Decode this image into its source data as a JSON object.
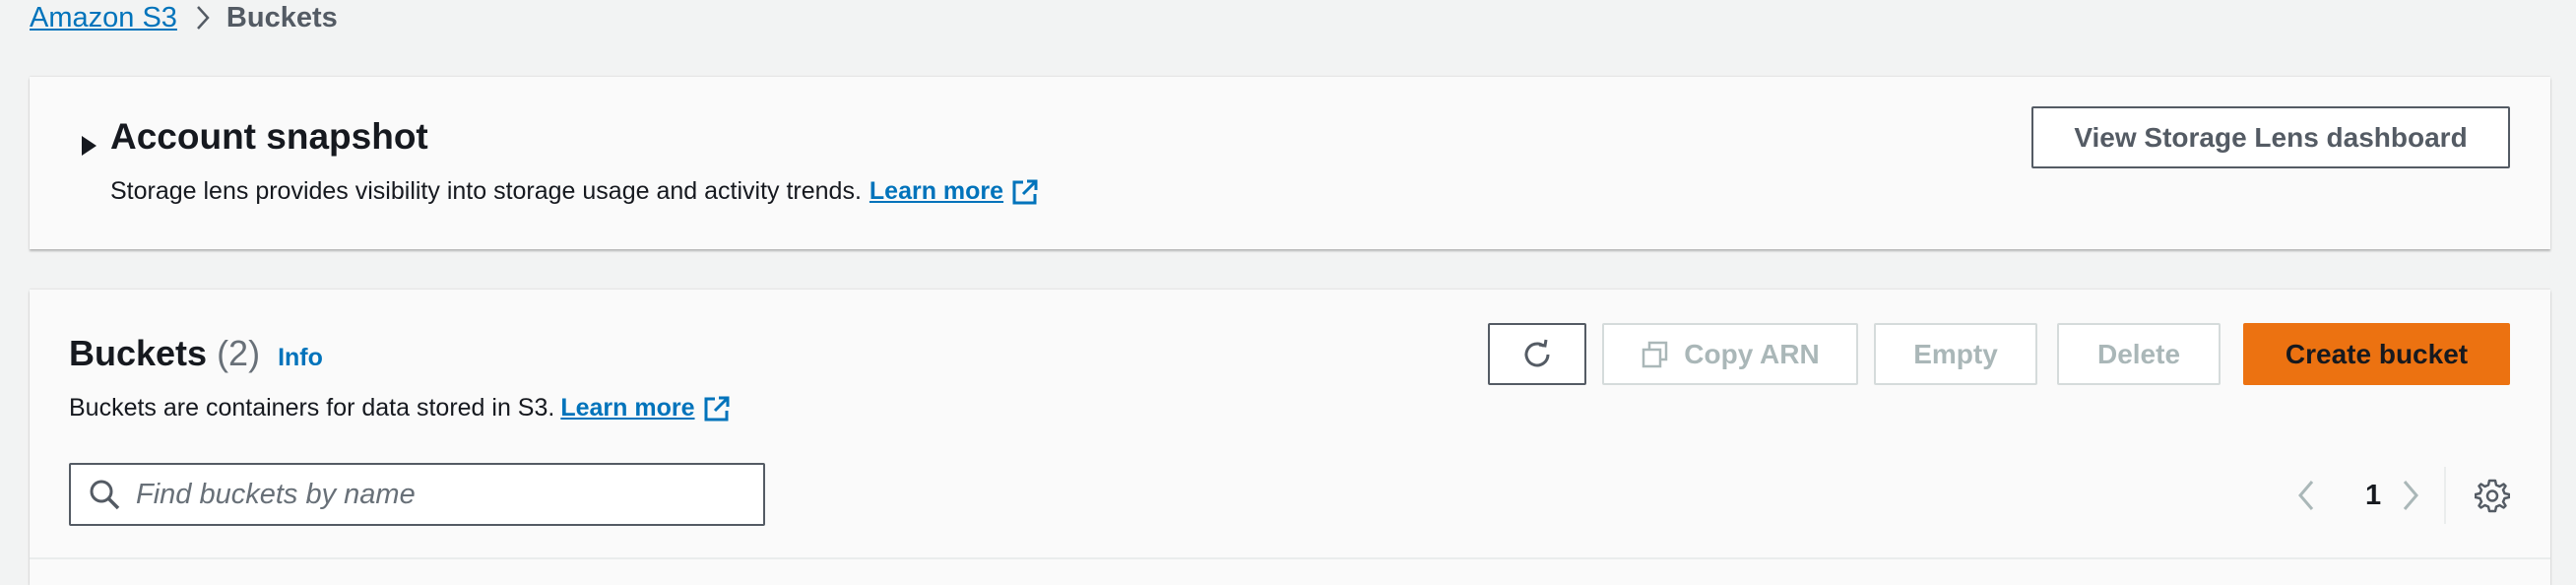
{
  "breadcrumb": {
    "root": "Amazon S3",
    "current": "Buckets"
  },
  "snapshot": {
    "title": "Account snapshot",
    "description": "Storage lens provides visibility into storage usage and activity trends.",
    "learn_more": "Learn more",
    "lens_button": "View Storage Lens dashboard"
  },
  "buckets": {
    "title": "Buckets",
    "count": "(2)",
    "info": "Info",
    "description": "Buckets are containers for data stored in S3.",
    "learn_more": "Learn more",
    "actions": {
      "copy_arn": "Copy ARN",
      "empty": "Empty",
      "delete": "Delete",
      "create": "Create bucket"
    },
    "search": {
      "placeholder": "Find buckets by name",
      "value": ""
    },
    "pagination": {
      "current_page": "1"
    }
  },
  "colors": {
    "accent": "#ec7211",
    "link": "#0073bb",
    "background": "#f2f3f3",
    "panel": "#fafafa",
    "disabled_text": "#aab7b8"
  },
  "icons": {
    "breadcrumb_separator": "chevron-right-icon",
    "snapshot_toggle": "caret-right-icon",
    "external": "external-link-icon",
    "refresh": "refresh-icon",
    "copy": "copy-icon",
    "search": "search-icon",
    "prev": "chevron-left-icon",
    "next": "chevron-right-icon",
    "settings": "gear-icon"
  }
}
